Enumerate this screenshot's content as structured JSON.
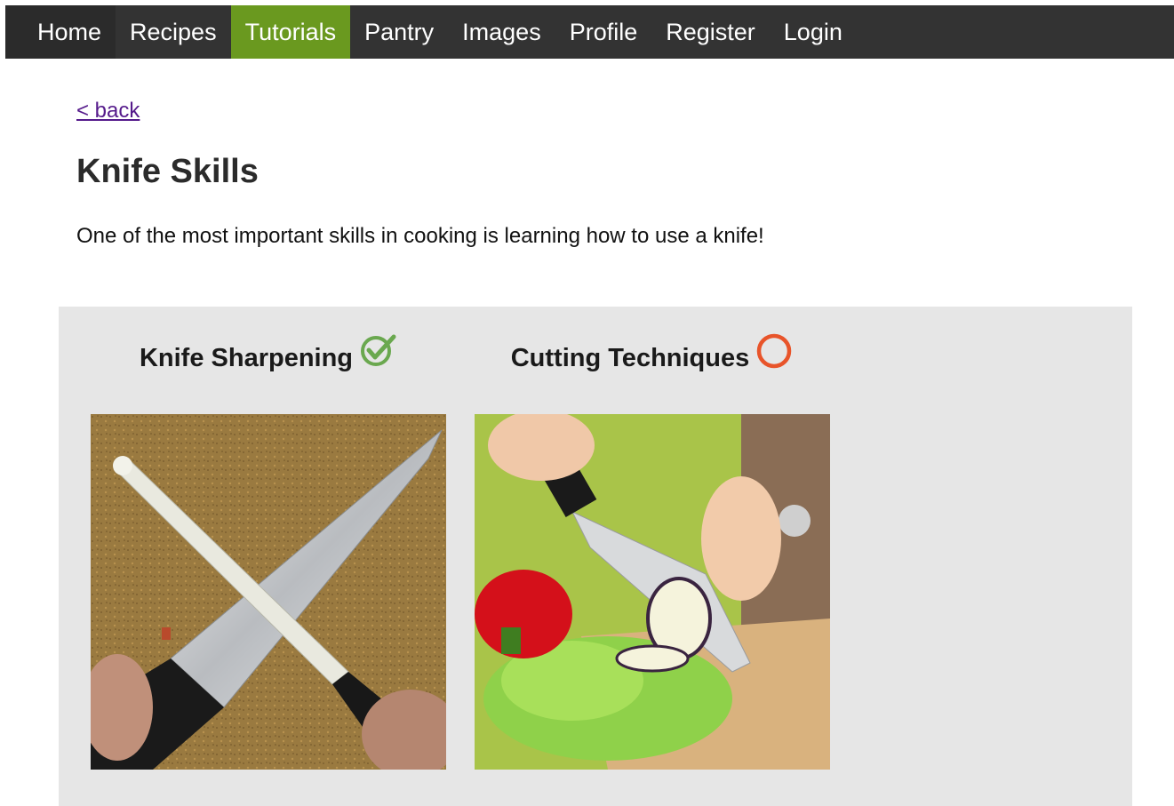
{
  "nav": {
    "items": [
      {
        "label": "Home"
      },
      {
        "label": "Recipes"
      },
      {
        "label": "Tutorials"
      },
      {
        "label": "Pantry"
      },
      {
        "label": "Images"
      },
      {
        "label": "Profile"
      },
      {
        "label": "Register"
      },
      {
        "label": "Login"
      }
    ],
    "active": "Tutorials"
  },
  "back_link": "< back",
  "page": {
    "title": "Knife Skills",
    "intro": "One of the most important skills in cooking is learning how to use a knife!"
  },
  "tutorials": [
    {
      "title": "Knife Sharpening",
      "status": "completed",
      "status_icon": "check-circle-icon"
    },
    {
      "title": "Cutting Techniques",
      "status": "not-started",
      "status_icon": "empty-circle-icon"
    }
  ],
  "colors": {
    "nav_bg": "#333333",
    "nav_active": "#6a991f",
    "panel_bg": "#e6e6e6",
    "complete": "#6aa84f",
    "incomplete": "#e8542a"
  }
}
